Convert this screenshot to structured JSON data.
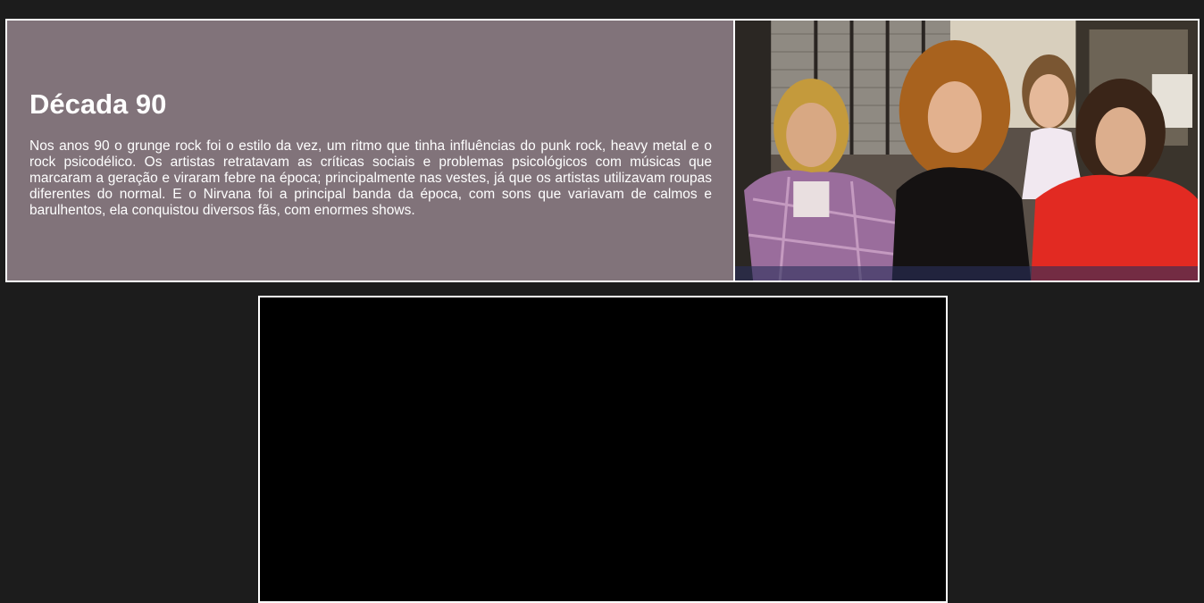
{
  "section": {
    "title": "Década 90",
    "body": "Nos anos 90 o grunge rock foi o estilo da vez, um ritmo que tinha influências do punk rock, heavy metal e o rock psicodélico. Os artistas retratavam as críticas sociais e problemas psicológicos com músicas que marcaram a geração e viraram febre na época; principalmente nas vestes, já que os artistas utilizavam roupas diferentes do normal. E o Nirvana foi a principal banda da época, com sons que variavam de calmos e barulhentos, ela conquistou diversos fãs, com enormes shows."
  },
  "colors": {
    "page_background": "#1c1c1c",
    "panel_background": "#81737a",
    "border": "#ffffff",
    "video_background": "#000000"
  }
}
